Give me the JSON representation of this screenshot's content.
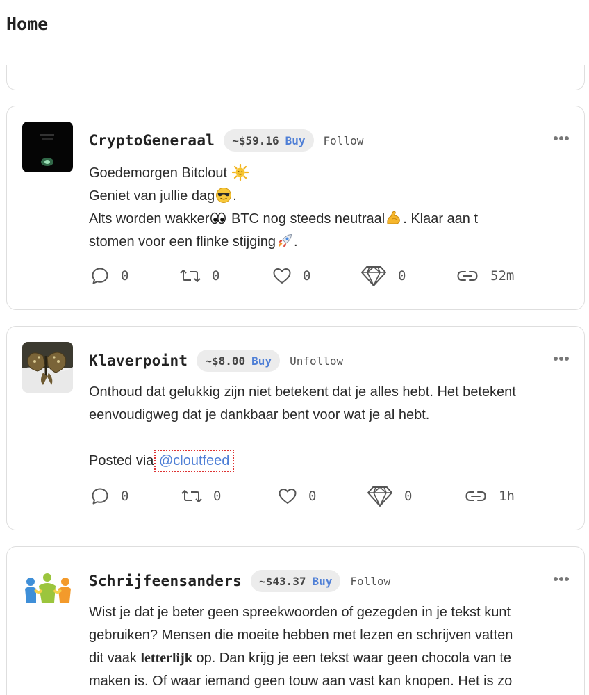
{
  "header": {
    "title": "Home"
  },
  "posts": [
    {
      "username": "CryptoGeneraal",
      "price": "~$59.16",
      "buy_label": "Buy",
      "follow_label": "Follow",
      "lines": [
        "Goedemorgen Bitclout",
        "Geniet van jullie dag",
        ".",
        "Alts worden wakker",
        " BTC nog steeds neutraal",
        ". Klaar aan t",
        "stomen voor een flinke stijging",
        "."
      ],
      "emojis": [
        "sun-emoji",
        "cool-face-emoji",
        "eyes-emoji",
        "flexed-biceps-emoji",
        "rocket-emoji"
      ],
      "comments": "0",
      "reclouts": "0",
      "likes": "0",
      "diamonds": "0",
      "time": "52m"
    },
    {
      "username": "Klaverpoint",
      "price": "~$8.00",
      "buy_label": "Buy",
      "follow_label": "Unfollow",
      "lines": [
        "Onthoud dat gelukkig zijn niet betekent dat je alles hebt. Het betekent",
        "eenvoudigweg dat je dankbaar bent voor wat je al hebt.",
        "Posted via ",
        "@cloutfeed"
      ],
      "comments": "0",
      "reclouts": "0",
      "likes": "0",
      "diamonds": "0",
      "time": "1h"
    },
    {
      "username": "Schrijfeensanders",
      "price": "~$43.37",
      "buy_label": "Buy",
      "follow_label": "Follow",
      "lines": [
        "Wist je dat je beter geen spreekwoorden of gezegden in je tekst kunt",
        "gebruiken? Mensen die moeite hebben met lezen en schrijven vatten",
        "dit vaak ",
        "letterlijk",
        " op. Dan krijg je een tekst waar geen chocola van te",
        "maken is. Of waar iemand geen touw aan vast kan knopen. Het is zo"
      ]
    }
  ],
  "colors": {
    "accent": "#4f7fd6",
    "pill_bg": "#ececec",
    "border": "#dedede"
  }
}
